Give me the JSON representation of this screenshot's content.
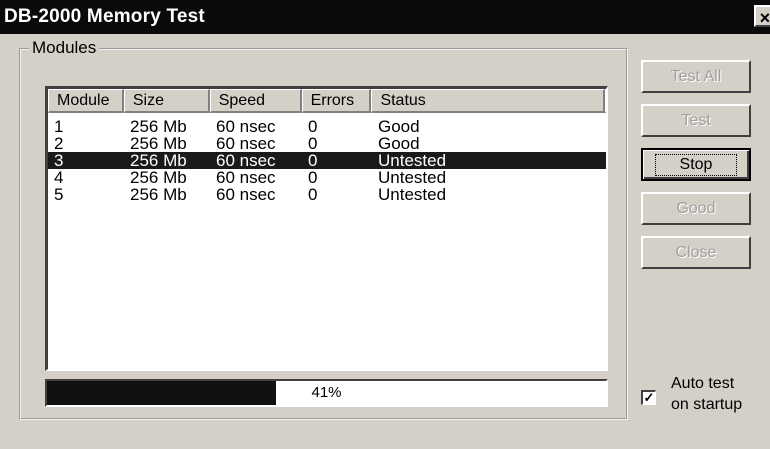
{
  "window": {
    "title": "DB-2000 Memory Test",
    "close_glyph": "×"
  },
  "modules_group": {
    "label": "Modules"
  },
  "table": {
    "columns": [
      "Module",
      "Size",
      "Speed",
      "Errors",
      "Status"
    ],
    "rows": [
      {
        "module": "1",
        "size": "256 Mb",
        "speed": "60 nsec",
        "errors": "0",
        "status": "Good"
      },
      {
        "module": "2",
        "size": "256 Mb",
        "speed": "60 nsec",
        "errors": "0",
        "status": "Good"
      },
      {
        "module": "3",
        "size": "256 Mb",
        "speed": "60 nsec",
        "errors": "0",
        "status": "Untested"
      },
      {
        "module": "4",
        "size": "256 Mb",
        "speed": "60 nsec",
        "errors": "0",
        "status": "Untested"
      },
      {
        "module": "5",
        "size": "256 Mb",
        "speed": "60 nsec",
        "errors": "0",
        "status": "Untested"
      }
    ],
    "selected_row": 2
  },
  "progress": {
    "label": "41%",
    "fraction": 0.41
  },
  "buttons": {
    "test_all": "Test All",
    "test": "Test",
    "stop": "Stop",
    "good": "Good",
    "close": "Close"
  },
  "auto_test": {
    "line1": "Auto test",
    "line2": "on startup",
    "checked": true,
    "check_glyph": "✓"
  }
}
